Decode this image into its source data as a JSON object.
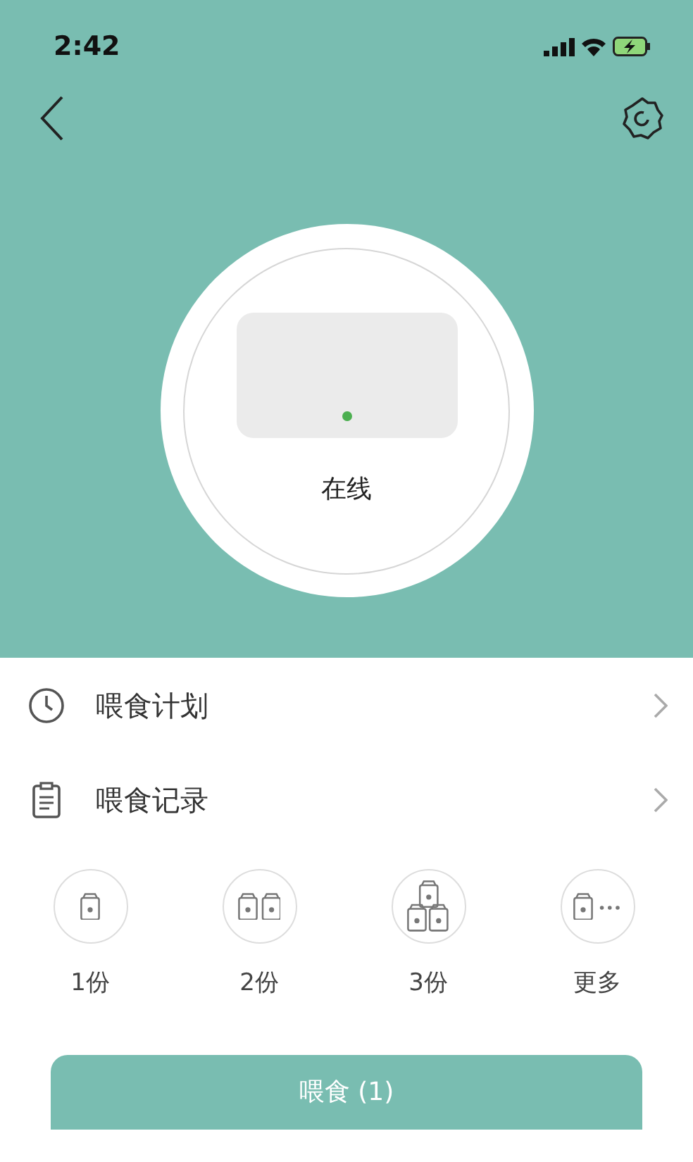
{
  "status_bar": {
    "time": "2:42"
  },
  "device": {
    "status": "在线",
    "online": true
  },
  "menu": [
    {
      "kind": "plan",
      "label": "喂食计划"
    },
    {
      "kind": "record",
      "label": "喂食记录"
    }
  ],
  "portions": [
    {
      "kind": "one",
      "label": "1份"
    },
    {
      "kind": "two",
      "label": "2份"
    },
    {
      "kind": "three",
      "label": "3份"
    },
    {
      "kind": "more",
      "label": "更多"
    }
  ],
  "feed_button": {
    "label": "喂食 (1)"
  }
}
